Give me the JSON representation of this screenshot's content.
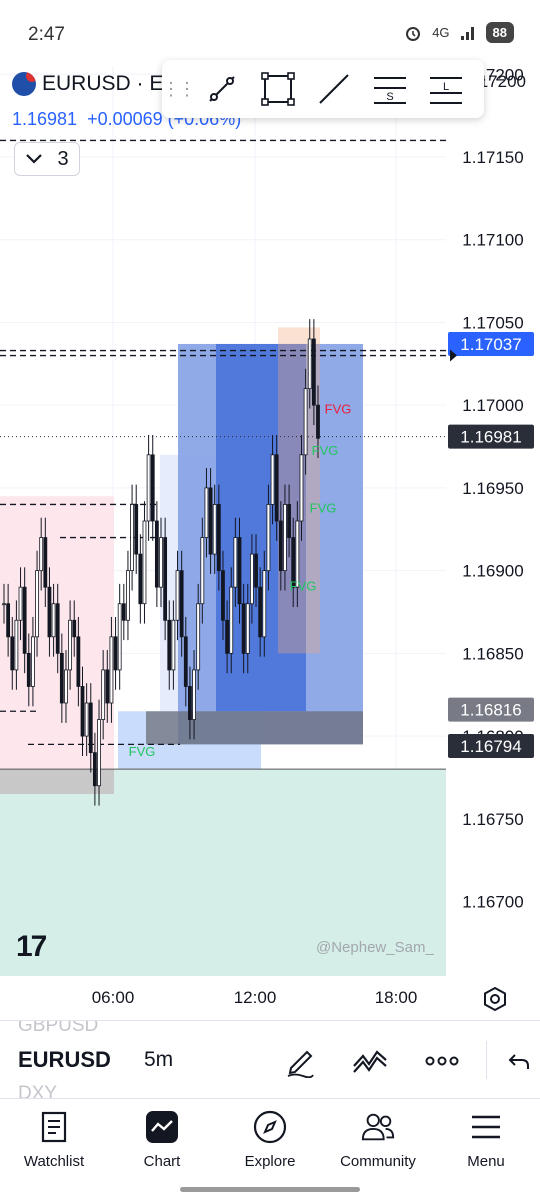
{
  "status_bar": {
    "time": "2:47",
    "network": "4G",
    "battery": "88"
  },
  "header": {
    "symbol": "EURUSD · E",
    "last_price": "1.16981",
    "change": "+0.00069 (+0.06%)",
    "collapse_count": "3"
  },
  "drawing_toolbar": {
    "tools": [
      "trend-line-icon",
      "rectangle-icon",
      "line-icon",
      "fib-s-icon",
      "fib-l-icon"
    ],
    "letters": {
      "s": "S",
      "l": "L"
    }
  },
  "chart_data": {
    "type": "candlestick",
    "y_ticks": [
      1.172,
      1.1715,
      1.171,
      1.1705,
      1.17,
      1.1695,
      1.169,
      1.1685,
      1.168,
      1.1675,
      1.167
    ],
    "y_tick_labels": [
      "1.17200",
      "1.17150",
      "1.17100",
      "1.17050",
      "1.17000",
      "1.16950",
      "1.16900",
      "1.16850",
      "1.16800",
      "1.16750",
      "1.16700"
    ],
    "ylim": [
      1.16655,
      1.17205
    ],
    "x_ticks": [
      "06:00",
      "12:00",
      "18:00"
    ],
    "grid": true,
    "price_badges": [
      {
        "label": "1.17037",
        "value": 1.17037,
        "color": "#2962ff"
      },
      {
        "label": "1.16981",
        "value": 1.16981,
        "color": "#2a2e39"
      },
      {
        "label": "1.16816",
        "value": 1.16816,
        "color": "#787b86"
      },
      {
        "label": "1.16794",
        "value": 1.16794,
        "color": "#2a2e39"
      }
    ],
    "fvg_labels": [
      {
        "text": "FVG",
        "color": "#e91e3c",
        "price": 1.16995
      },
      {
        "text": "FVG",
        "color": "#22c55e",
        "price": 1.1697
      },
      {
        "text": "FVG",
        "color": "#22c55e",
        "price": 1.16935
      },
      {
        "text": "FVG",
        "color": "#22c55e",
        "price": 1.16888
      },
      {
        "text": "FVG",
        "color": "#22c55e",
        "price": 1.16788
      }
    ],
    "levels": [
      1.1716,
      1.17033,
      1.1703,
      1.1694,
      1.1692,
      1.16815,
      1.16795
    ],
    "series": [
      {
        "values": [
          1.1688,
          1.1686,
          1.1684,
          1.1687,
          1.1689,
          1.1685,
          1.1683,
          1.1686,
          1.169,
          1.1692,
          1.1689,
          1.1686,
          1.1688,
          1.1685,
          1.1682,
          1.1684,
          1.1687,
          1.1686,
          1.1683,
          1.168,
          1.1682,
          1.1679,
          1.1677,
          1.1681,
          1.1684,
          1.1682,
          1.1686,
          1.1684,
          1.1688,
          1.1687,
          1.169,
          1.1694,
          1.1691,
          1.1688,
          1.1693,
          1.1697,
          1.1693,
          1.1689,
          1.1692,
          1.1687,
          1.1684,
          1.1687,
          1.169,
          1.1686,
          1.1683,
          1.1681,
          1.1684,
          1.1688,
          1.1692,
          1.1695,
          1.1691,
          1.1694,
          1.169,
          1.1687,
          1.1685,
          1.1689,
          1.1692,
          1.1688,
          1.1685,
          1.1688,
          1.1691,
          1.1689,
          1.1686,
          1.169,
          1.1694,
          1.1697,
          1.1693,
          1.169,
          1.1694,
          1.1692,
          1.1689,
          1.1693,
          1.1697,
          1.1701,
          1.1704,
          1.17,
          1.1698
        ]
      }
    ]
  },
  "watermark": {
    "logo": "17",
    "author": "@Nephew_Sam_"
  },
  "symbol_strip": {
    "prev": "GBPUSD",
    "current": "EURUSD",
    "interval": "5m",
    "next": "DXY"
  },
  "nav": [
    {
      "label": "Watchlist",
      "icon": "watchlist-icon"
    },
    {
      "label": "Chart",
      "icon": "chart-icon"
    },
    {
      "label": "Explore",
      "icon": "compass-icon"
    },
    {
      "label": "Community",
      "icon": "community-icon"
    },
    {
      "label": "Menu",
      "icon": "menu-icon"
    }
  ]
}
